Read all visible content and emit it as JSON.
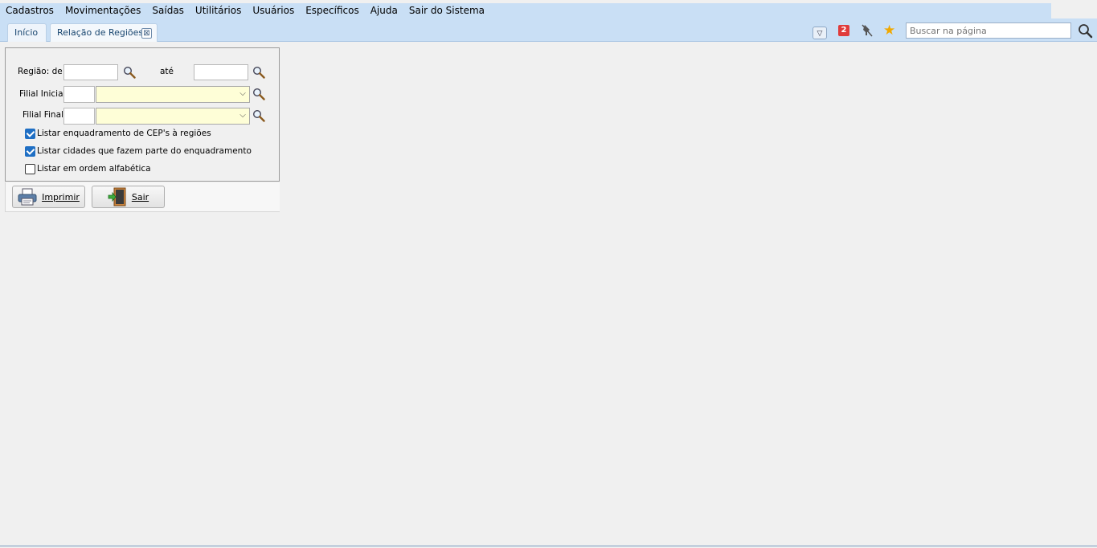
{
  "menu": {
    "items": [
      {
        "label": "Cadastros"
      },
      {
        "label": "Movimentações"
      },
      {
        "label": "Saídas"
      },
      {
        "label": "Utilitários"
      },
      {
        "label": "Usuários"
      },
      {
        "label": "Específicos"
      },
      {
        "label": "Ajuda"
      },
      {
        "label": "Sair do Sistema"
      }
    ]
  },
  "tabs": {
    "home_label": "Início",
    "active_label": "Relação de Regiões",
    "close_glyph": "⊠"
  },
  "toolbar": {
    "badge_count": "2",
    "search_placeholder": "Buscar na página",
    "icons": [
      "dropdown-icon",
      "notification-badge-icon",
      "unpin-icon",
      "favorite-star-icon",
      "search-icon"
    ]
  },
  "form": {
    "regiao_label": "Região: de",
    "ate_label": "até",
    "filial_inicial_label": "Filial Inicial",
    "filial_final_label": "Filial Final",
    "regiao_de_value": "",
    "regiao_ate_value": "",
    "filial_inicial_code": "",
    "filial_inicial_name": "",
    "filial_final_code": "",
    "filial_final_name": "",
    "combo_bg_color": "#fefed7",
    "options": [
      {
        "label": "Listar enquadramento de CEP's à regiões",
        "checked": true
      },
      {
        "label": "Listar cidades que fazem parte do enquadramento",
        "checked": true
      },
      {
        "label": "Listar em ordem alfabética",
        "checked": false
      }
    ]
  },
  "buttons": {
    "print_label": "Imprimir",
    "exit_label": "Sair"
  },
  "colors": {
    "menubar": "#c9dff5",
    "checkbox_on": "#1f6fc4"
  }
}
